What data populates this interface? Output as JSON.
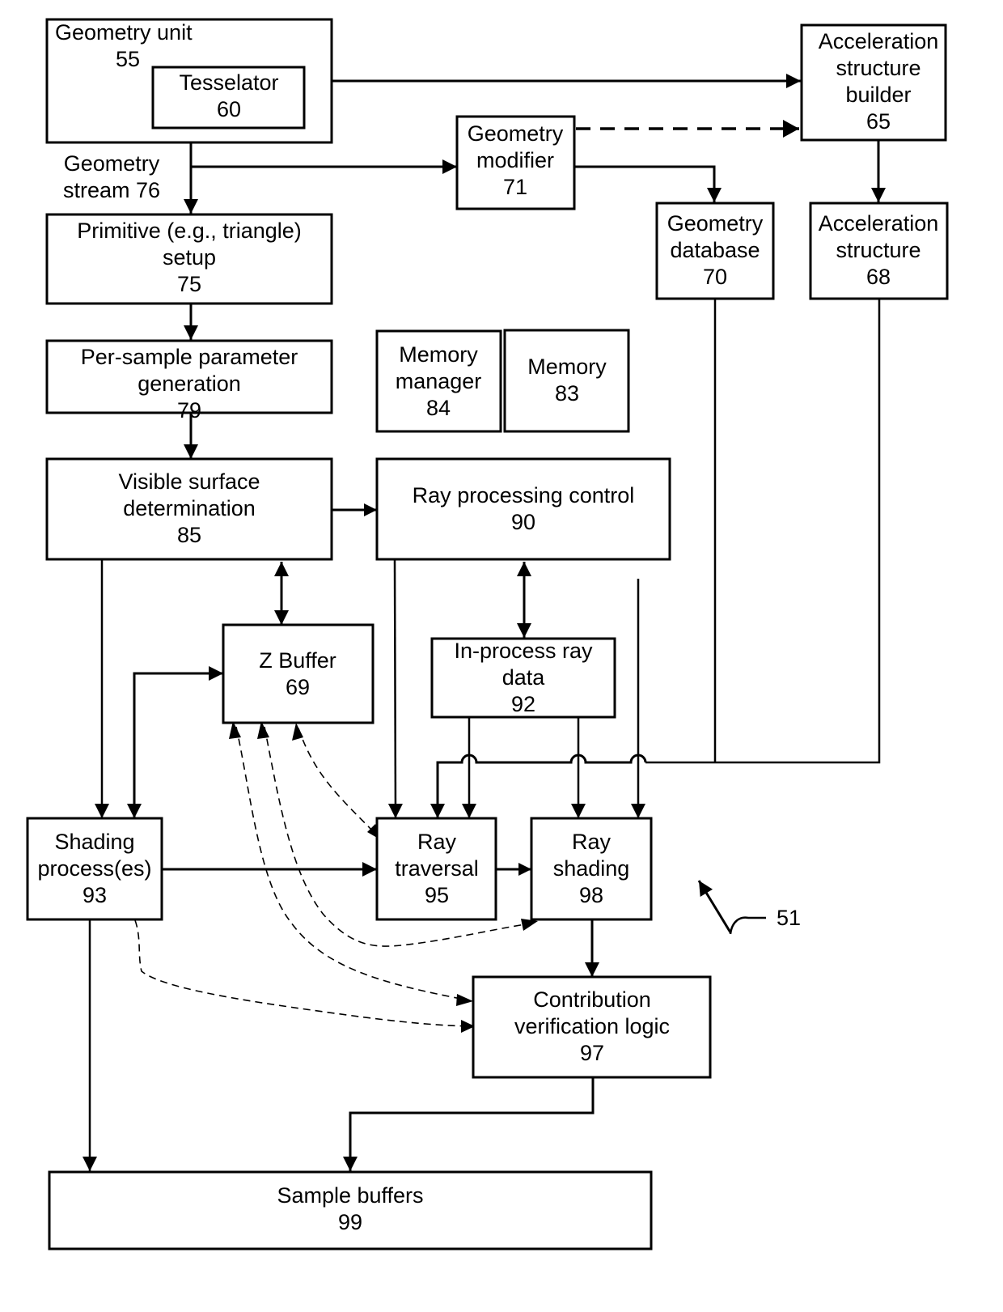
{
  "figure": {
    "reference_label": "51",
    "colors": {
      "line": "#000000",
      "background": "#ffffff"
    }
  },
  "blocks": {
    "geometry_unit": {
      "lines": [
        "Geometry  unit",
        "55"
      ]
    },
    "tesselator": {
      "lines": [
        "Tesselator",
        "60"
      ]
    },
    "accel_builder": {
      "lines": [
        "Acceleration",
        "structure",
        "builder",
        "65"
      ]
    },
    "geometry_modifier": {
      "lines": [
        "Geometry",
        "modifier",
        "71"
      ]
    },
    "geometry_stream_label": {
      "lines": [
        "Geometry",
        "stream 76"
      ]
    },
    "primitive_setup": {
      "lines": [
        "Primitive (e.g., triangle)",
        "setup",
        "75"
      ]
    },
    "geometry_database": {
      "lines": [
        "Geometry",
        "database",
        "70"
      ]
    },
    "accel_structure": {
      "lines": [
        "Acceleration",
        "structure",
        "68"
      ]
    },
    "per_sample": {
      "lines": [
        "Per-sample parameter",
        "generation",
        "79"
      ]
    },
    "memory_manager": {
      "lines": [
        "Memory",
        "manager",
        "84"
      ]
    },
    "memory": {
      "lines": [
        "Memory",
        "83"
      ]
    },
    "visible_surface": {
      "lines": [
        "Visible surface",
        "determination",
        "85"
      ]
    },
    "ray_processing_control": {
      "lines": [
        "Ray processing control",
        "90"
      ]
    },
    "z_buffer": {
      "lines": [
        "Z Buffer",
        "69"
      ]
    },
    "in_process_ray_data": {
      "lines": [
        "In-process ray",
        "data",
        "92"
      ]
    },
    "shading_processes": {
      "lines": [
        "Shading",
        "process(es)",
        "93"
      ]
    },
    "ray_traversal": {
      "lines": [
        "Ray",
        "traversal",
        "95"
      ]
    },
    "ray_shading": {
      "lines": [
        "Ray",
        "shading",
        "98"
      ]
    },
    "contribution_verification": {
      "lines": [
        "Contribution",
        "verification logic",
        "97"
      ]
    },
    "sample_buffers": {
      "lines": [
        "Sample buffers",
        "99"
      ]
    }
  },
  "connections": [
    {
      "from": "geometry_unit",
      "to": "accel_builder",
      "style": "solid"
    },
    {
      "from": "geometry_modifier",
      "to": "accel_builder",
      "style": "dashed"
    },
    {
      "from": "geometry_unit",
      "to": "primitive_setup",
      "style": "solid",
      "label": "Geometry stream 76"
    },
    {
      "from": "geometry_unit",
      "to": "geometry_modifier",
      "style": "solid"
    },
    {
      "from": "geometry_modifier",
      "to": "geometry_database",
      "style": "solid"
    },
    {
      "from": "accel_builder",
      "to": "accel_structure",
      "style": "solid"
    },
    {
      "from": "primitive_setup",
      "to": "per_sample",
      "style": "solid"
    },
    {
      "from": "per_sample",
      "to": "visible_surface",
      "style": "solid"
    },
    {
      "from": "visible_surface",
      "to": "ray_processing_control",
      "style": "solid"
    },
    {
      "from": "visible_surface",
      "to": "z_buffer",
      "style": "solid",
      "bidirectional": true
    },
    {
      "from": "ray_processing_control",
      "to": "in_process_ray_data",
      "style": "solid",
      "bidirectional": true
    },
    {
      "from": "visible_surface",
      "to": "shading_processes",
      "style": "solid"
    },
    {
      "from": "z_buffer",
      "to": "shading_processes",
      "style": "solid",
      "bidirectional": true
    },
    {
      "from": "ray_processing_control",
      "to": "ray_traversal",
      "style": "solid"
    },
    {
      "from": "ray_processing_control",
      "to": "ray_shading",
      "style": "solid"
    },
    {
      "from": "in_process_ray_data",
      "to": "ray_traversal",
      "style": "solid"
    },
    {
      "from": "in_process_ray_data",
      "to": "ray_shading",
      "style": "solid"
    },
    {
      "from": "geometry_database",
      "to": "ray_traversal",
      "style": "solid"
    },
    {
      "from": "accel_structure",
      "to": "ray_traversal",
      "style": "solid"
    },
    {
      "from": "shading_processes",
      "to": "ray_traversal",
      "style": "solid"
    },
    {
      "from": "ray_traversal",
      "to": "ray_shading",
      "style": "solid"
    },
    {
      "from": "z_buffer",
      "to": "ray_traversal",
      "style": "dashed",
      "bidirectional": true
    },
    {
      "from": "z_buffer",
      "to": "ray_shading",
      "style": "dashed",
      "bidirectional": true
    },
    {
      "from": "z_buffer",
      "to": "contribution_verification",
      "style": "dashed",
      "bidirectional": true
    },
    {
      "from": "shading_processes",
      "to": "contribution_verification",
      "style": "dashed"
    },
    {
      "from": "ray_shading",
      "to": "contribution_verification",
      "style": "solid"
    },
    {
      "from": "shading_processes",
      "to": "sample_buffers",
      "style": "solid"
    },
    {
      "from": "contribution_verification",
      "to": "sample_buffers",
      "style": "solid"
    }
  ]
}
